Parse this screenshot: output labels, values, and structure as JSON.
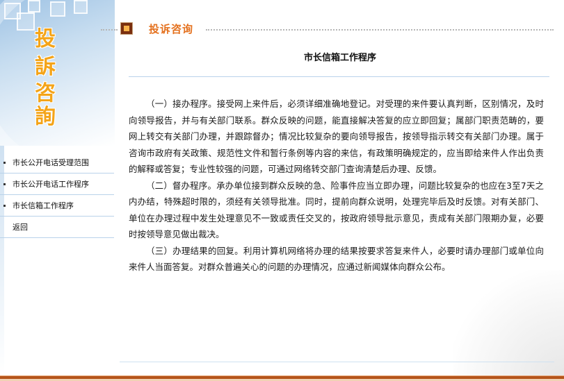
{
  "banner": {
    "chars": [
      "投",
      "訴",
      "咨",
      "詢"
    ]
  },
  "nav": {
    "items": [
      {
        "label": "市长公开电话受理范围",
        "bullet": true
      },
      {
        "label": "市长公开电话工作程序",
        "bullet": true
      },
      {
        "label": "市长信箱工作程序",
        "bullet": true
      },
      {
        "label": "返回",
        "bullet": false
      }
    ]
  },
  "header": {
    "title": "投诉咨询",
    "icon": "square-bullet-icon"
  },
  "content": {
    "title": "市长信箱工作程序",
    "paragraphs": [
      "（一）接办程序。接受网上来件后，必须详细准确地登记。对受理的来件要认真判断，区别情况，及时向领导报告，并与有关部门联系。群众反映的问题，能直接解决答复的应立即回复；属部门职责范畴的，要网上转交有关部门办理，并跟踪督办；情况比较复杂的要向领导报告，按领导指示转交有关部门办理。属于咨询市政府有关政策、规范性文件和暂行条例等内容的来信，有政策明确规定的，应当即给来件人作出负责的解释或答复；专业性较强的问题，可通过网络转交部门查询清楚后办理、反馈。",
      "（二）督办程序。承办单位接到群众反映的急、险事件应当立即办理，问题比较复杂的也应在3至7天之内办结，特殊超时限的，须经有关领导批准。同时，提前向群众说明，处理完毕后及时反馈。对有关部门、单位在办理过程中发生处理意见不一致或责任交叉的，按政府领导批示意见，责成有关部门限期办复，必要时按领导意见做出裁决。",
      "（三）办理结果的回复。利用计算机网络将办理的结果按要求答复来件人，必要时请办理部门或单位向来件人当面答复。对群众普遍关心的问题的办理情况，应通过新闻媒体向群众公布。"
    ]
  },
  "colors": {
    "header_title": "#e4701d",
    "banner_chars": "#f4a419",
    "footer_bar": "#b5551b",
    "nav_divider": "#b9d2ea"
  }
}
